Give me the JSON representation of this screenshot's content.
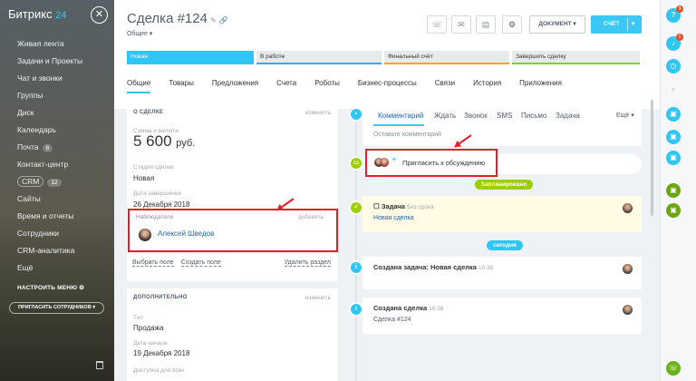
{
  "sidebar": {
    "logo": "Битрикс",
    "logo_suffix": "24",
    "items": [
      {
        "label": "Живая лента"
      },
      {
        "label": "Задачи и Проекты"
      },
      {
        "label": "Чат и звонки"
      },
      {
        "label": "Группы"
      },
      {
        "label": "Диск"
      },
      {
        "label": "Календарь"
      },
      {
        "label": "Почта",
        "count": "8"
      },
      {
        "label": "Контакт-центр"
      },
      {
        "label": "CRM",
        "count": "12"
      },
      {
        "label": "Сайты"
      },
      {
        "label": "Время и отчеты"
      },
      {
        "label": "Сотрудники"
      },
      {
        "label": "CRM-аналитика"
      },
      {
        "label": "Ещё"
      }
    ],
    "configure_menu": "НАСТРОИТЬ МЕНЮ",
    "invite_users": "ПРИГЛАСИТЬ СОТРУДНИКОВ"
  },
  "header": {
    "title": "Сделка #124",
    "category": "Общее",
    "document_button": "ДОКУМЕНТ",
    "invoice_button": "СЧЁТ"
  },
  "stages": [
    {
      "label": "Новая",
      "color": "#2fc6f6"
    },
    {
      "label": "В работе",
      "color": "#39a8ef"
    },
    {
      "label": "Финальный счёт",
      "color": "#f7a700"
    },
    {
      "label": "Завершить сделку",
      "color": "#7bd500"
    }
  ],
  "tabs": [
    "Общие",
    "Товары",
    "Предложения",
    "Счета",
    "Роботы",
    "Бизнес-процессы",
    "Связи",
    "История",
    "Приложения"
  ],
  "about": {
    "heading": "О СДЕЛКЕ",
    "edit": "изменить",
    "amount_label": "Сумма и валюта",
    "amount": "5 600",
    "currency": "руб.",
    "stage_label": "Стадия сделки",
    "stage_value": "Новая",
    "close_label": "Дата завершения",
    "close_value": "26 Декабря 2018",
    "observers_label": "Наблюдатели",
    "observers_add": "добавить",
    "observer_name": "Алексей Шведов",
    "select_field": "Выбрать поле",
    "create_field": "Создать поле",
    "delete_section": "Удалить раздел"
  },
  "extra": {
    "heading": "ДОПОЛНИТЕЛЬНО",
    "edit": "изменить",
    "type_label": "Тип",
    "type_value": "Продажа",
    "start_label": "Дата начала",
    "start_value": "19 Декабря 2018",
    "access_label": "Доступна для всех"
  },
  "composer": {
    "tabs": [
      "Комментарий",
      "Ждать",
      "Звонок",
      "SMS",
      "Письмо",
      "Задача"
    ],
    "more": "Ещё",
    "placeholder": "Оставьте комментарий",
    "invite_text": "Пригласить к обсуждению"
  },
  "timeline": {
    "planned_label": "Запланировано",
    "today_label": "сегодня",
    "task": {
      "title": "Задача",
      "deadline": "Без срока",
      "link": "Новая сделка"
    },
    "entry1": {
      "title": "Создана задача: Новая сделка",
      "time": "16:38"
    },
    "entry2": {
      "title": "Создана сделка",
      "time": "16:38",
      "sub": "Сделка #124"
    }
  },
  "right_panel": {
    "help_badge": "3",
    "notify_badge": "5"
  }
}
